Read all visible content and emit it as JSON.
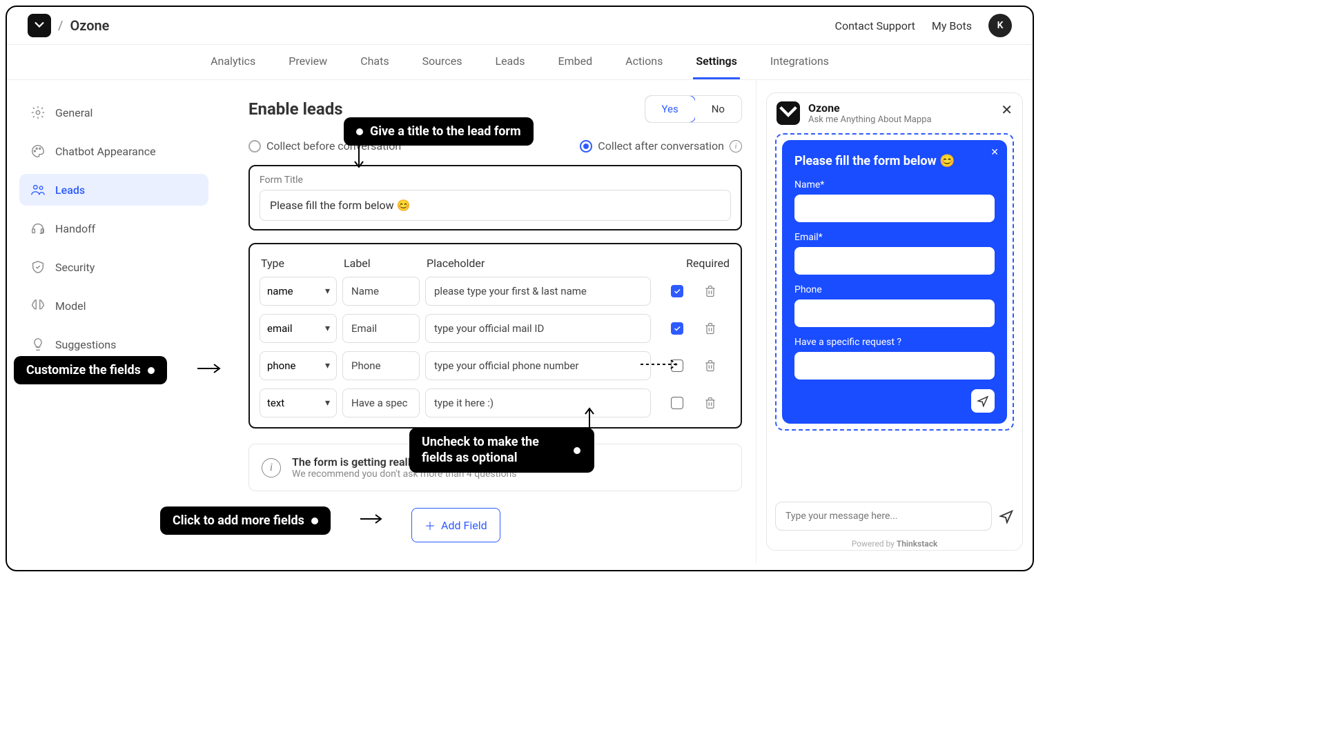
{
  "header": {
    "app_name": "Ozone",
    "contact": "Contact Support",
    "my_bots": "My Bots",
    "avatar_letter": "K"
  },
  "tabs": [
    "Analytics",
    "Preview",
    "Chats",
    "Sources",
    "Leads",
    "Embed",
    "Actions",
    "Settings",
    "Integrations"
  ],
  "active_tab": "Settings",
  "sidebar": {
    "items": [
      {
        "icon": "gear",
        "label": "General"
      },
      {
        "icon": "palette",
        "label": "Chatbot Appearance"
      },
      {
        "icon": "users",
        "label": "Leads"
      },
      {
        "icon": "headset",
        "label": "Handoff"
      },
      {
        "icon": "shield",
        "label": "Security"
      },
      {
        "icon": "brain",
        "label": "Model"
      },
      {
        "icon": "bulb",
        "label": "Suggestions"
      }
    ],
    "active": "Leads"
  },
  "leads": {
    "title": "Enable leads",
    "yes": "Yes",
    "no": "No",
    "collect_before": "Collect before conversation",
    "collect_after": "Collect after conversation",
    "form_title_label": "Form Title",
    "form_title_value": "Please fill the form below 😊",
    "columns": {
      "type": "Type",
      "label": "Label",
      "placeholder": "Placeholder",
      "required": "Required"
    },
    "fields": [
      {
        "type": "name",
        "label": "Name",
        "placeholder": "please type your first & last name",
        "required": true
      },
      {
        "type": "email",
        "label": "Email",
        "placeholder": "type your official mail ID",
        "required": true
      },
      {
        "type": "phone",
        "label": "Phone",
        "placeholder": "type your official phone number",
        "required": false
      },
      {
        "type": "text",
        "label": "Have a spec",
        "placeholder": "type it here :)",
        "required": false
      }
    ],
    "notice_title": "The form is getting really long",
    "notice_sub": "We recommend you don't ask more than 4 questions",
    "add_field": "Add Field"
  },
  "preview": {
    "bot_name": "Ozone",
    "bot_sub": "Ask me Anything About Mappa",
    "form_title": "Please fill the form below 😊",
    "fields": [
      {
        "label": "Name*"
      },
      {
        "label": "Email*"
      },
      {
        "label": "Phone"
      },
      {
        "label": "Have a specific request ?"
      }
    ],
    "input_placeholder": "Type your message here...",
    "powered_prefix": "Powered by ",
    "powered_brand": "Thinkstack"
  },
  "annotations": {
    "title_tip": "Give a title to the lead form",
    "customize": "Customize the fields",
    "uncheck": "Uncheck to make the fields as optional",
    "add": "Click to add more fields"
  }
}
